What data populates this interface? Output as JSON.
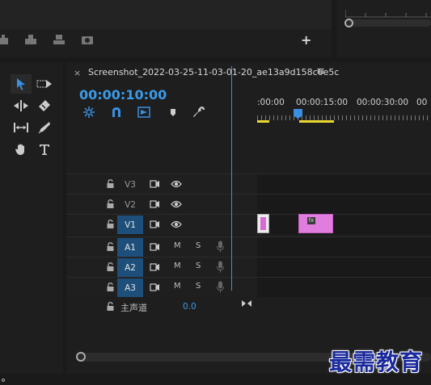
{
  "top_toolbar": {
    "icons": [
      "insert-clip-icon",
      "overwrite-clip-icon",
      "lift-icon",
      "extract-icon",
      "export-frame-icon"
    ],
    "add_button_label": "+"
  },
  "tools": [
    "selection-tool",
    "track-select-forward-tool",
    "ripple-edit-tool",
    "razor-tool",
    "slip-tool",
    "pen-tool",
    "hand-tool",
    "type-tool"
  ],
  "timeline": {
    "close_label": "×",
    "title": "Screenshot_2022-03-25-11-03-01-20_ae13a9d158c6e5c",
    "menu_label": "≡",
    "timecode": "00:00:10:00",
    "ruler_labels": [
      ":00:00",
      "00:00:15:00",
      "00:00:30:00",
      "00"
    ],
    "tracks": [
      {
        "name": "V3",
        "type": "video",
        "active": false
      },
      {
        "name": "V2",
        "type": "video",
        "active": false
      },
      {
        "name": "V1",
        "type": "video",
        "active": true
      },
      {
        "name": "A1",
        "type": "audio",
        "active": true,
        "m": "M",
        "s": "S"
      },
      {
        "name": "A2",
        "type": "audio",
        "active": true,
        "m": "M",
        "s": "S"
      },
      {
        "name": "A3",
        "type": "audio",
        "active": true,
        "m": "M",
        "s": "S"
      }
    ],
    "master": {
      "label": "主声道",
      "value": "0.0"
    },
    "clip_fx_label": "fx"
  },
  "watermark": "最需教育",
  "colors": {
    "accent": "#3a9be8",
    "clip": "#e27de0",
    "work_area": "#e8d830",
    "active_track": "#1d4f7a"
  }
}
